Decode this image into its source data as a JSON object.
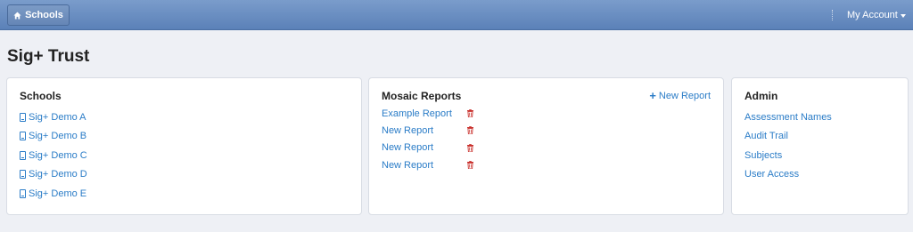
{
  "navbar": {
    "brand_label": "Schools",
    "account_label": "My Account"
  },
  "page": {
    "title": "Sig+ Trust"
  },
  "schools_panel": {
    "title": "Schools",
    "items": [
      "Sig+ Demo A",
      "Sig+ Demo B",
      "Sig+ Demo C",
      "Sig+ Demo D",
      "Sig+ Demo E"
    ]
  },
  "reports_panel": {
    "title": "Mosaic Reports",
    "new_label": "New Report",
    "items": [
      "Example Report",
      "New Report",
      "New Report",
      "New Report"
    ]
  },
  "admin_panel": {
    "title": "Admin",
    "items": [
      "Assessment Names",
      "Audit Trail",
      "Subjects",
      "User Access"
    ]
  },
  "colors": {
    "link": "#2a7cc7",
    "delete": "#c9302c",
    "navbar": "#6386bb"
  },
  "icons": [
    "home-icon",
    "school-icon",
    "plus-icon",
    "trash-icon",
    "caret-down-icon"
  ]
}
